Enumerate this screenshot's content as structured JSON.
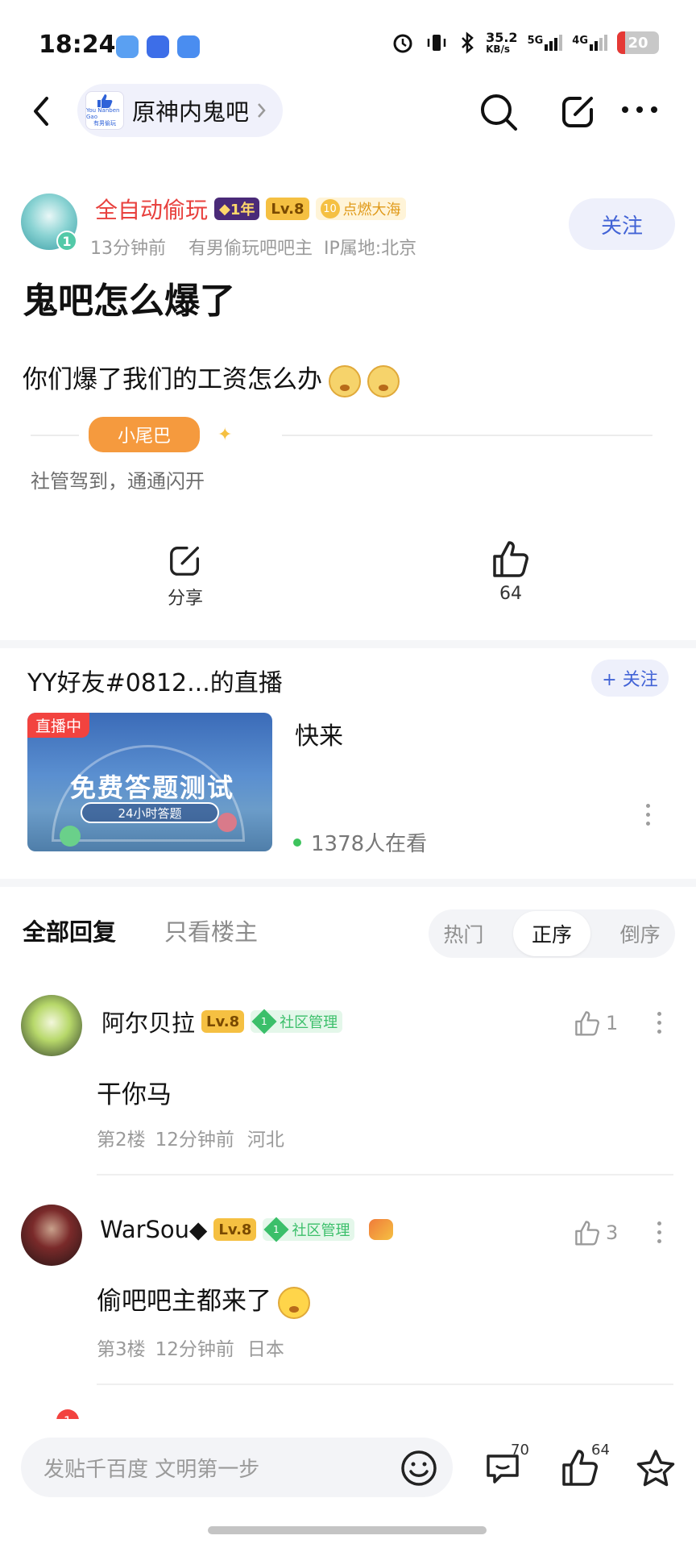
{
  "status_bar": {
    "time": "18:24",
    "net_speed": "35.2",
    "net_unit": "KB/s",
    "sig1": "5G",
    "sig2": "4G",
    "battery": "20"
  },
  "nav": {
    "forum_name": "原神内鬼吧",
    "forum_logo_line1": "You Nanben Gao",
    "forum_logo_line2": "有男偷玩"
  },
  "post": {
    "author": "全自动偷玩",
    "years_badge": "1年",
    "level": "Lv.8",
    "fire_level": "10",
    "fire_label": "点燃大海",
    "avatar_badge": "1",
    "time": "13分钟前",
    "role": "有男偷玩吧吧主",
    "ip": "IP属地:北京",
    "follow": "关注",
    "title": "鬼吧怎么爆了",
    "body": "你们爆了我们的工资怎么办",
    "tail_tag": "小尾巴",
    "tail_text": "社管驾到，通通闪开",
    "share_label": "分享",
    "like_count": "64"
  },
  "live": {
    "title": "YY好友#0812...的直播",
    "follow": "+ 关注",
    "badge": "直播中",
    "thumb_title": "免费答题测试",
    "thumb_sub": "24小时答题",
    "desc": "快来",
    "viewers": "1378人在看"
  },
  "tabs": {
    "all": "全部回复",
    "owner_only": "只看楼主",
    "seg": [
      "热门",
      "正序",
      "倒序"
    ]
  },
  "replies": [
    {
      "name": "阿尔贝拉",
      "level": "Lv.8",
      "mgr_num": "1",
      "mgr_label": "社区管理",
      "likes": "1",
      "text": "干你马",
      "floor": "第2楼",
      "time": "12分钟前",
      "loc": "河北"
    },
    {
      "name": "WarSou◆",
      "level": "Lv.8",
      "mgr_num": "1",
      "mgr_label": "社区管理",
      "likes": "3",
      "text": "偷吧吧主都来了",
      "floor": "第3楼",
      "time": "12分钟前",
      "loc": "日本"
    }
  ],
  "bottom": {
    "placeholder": "发贴千百度 文明第一步",
    "comment_count": "70",
    "like_count": "64",
    "notif_count": "1"
  },
  "colors": {
    "accent": "#4263d6",
    "author_red": "#e8413e",
    "live_red": "#f2433f",
    "mgr_green": "#3bbf6a"
  }
}
